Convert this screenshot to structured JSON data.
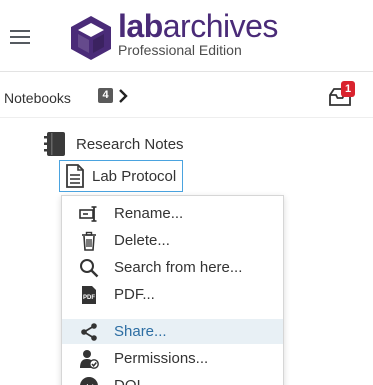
{
  "brand": {
    "name_bold": "lab",
    "name_light": "archives",
    "edition": "Professional Edition",
    "color": "#4a2b78"
  },
  "nav": {
    "notebooks_label": "Notebooks",
    "notebooks_count": "4",
    "inbox_badge": "1"
  },
  "tree": {
    "notebook": {
      "label": "Research Notes",
      "icon": "notebook-icon"
    },
    "page": {
      "label": "Lab Protocol",
      "icon": "page-icon"
    }
  },
  "context_menu": {
    "items": [
      {
        "label": "Rename...",
        "icon": "rename-icon"
      },
      {
        "label": "Delete...",
        "icon": "trash-icon"
      },
      {
        "label": "Search from here...",
        "icon": "search-icon"
      },
      {
        "label": "PDF...",
        "icon": "pdf-icon"
      },
      {
        "label": "Share...",
        "icon": "share-icon",
        "highlighted": true
      },
      {
        "label": "Permissions...",
        "icon": "permissions-icon"
      },
      {
        "label": "DOI",
        "icon": "doi-icon"
      }
    ]
  },
  "colors": {
    "accent": "#4aa3df",
    "highlight": "#e8f0f5",
    "badge": "#d9232e",
    "icon_dark": "#3a3a3a"
  }
}
